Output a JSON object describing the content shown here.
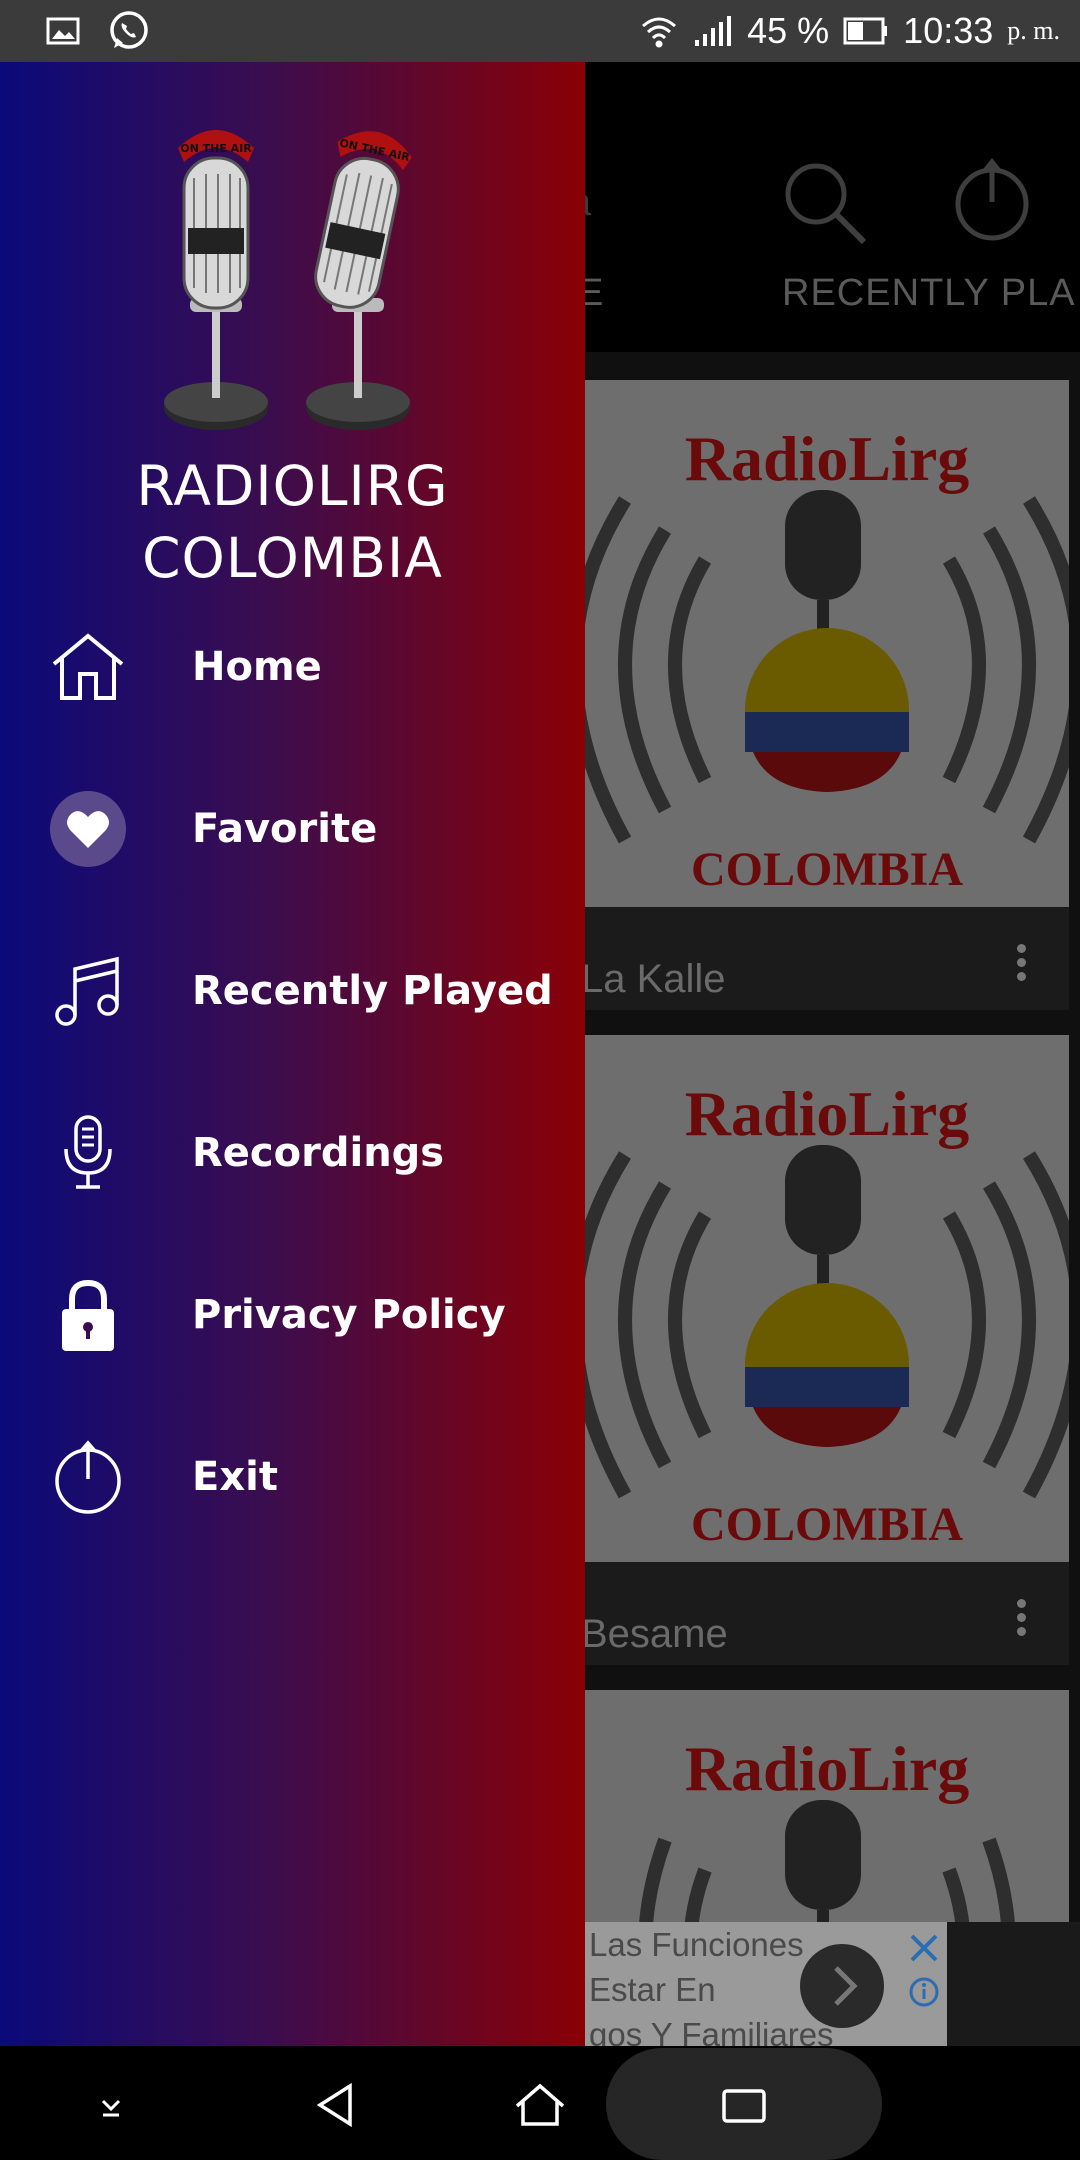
{
  "status_bar": {
    "battery": "45 %",
    "time": "10:33",
    "ampm": "p. m.",
    "icons": [
      "gallery-icon",
      "whatsapp-icon",
      "wifi-icon",
      "signal-icon",
      "battery-icon"
    ]
  },
  "background_app": {
    "title_fragment": "ia",
    "tabs": [
      "E",
      "RECENTLY PLA"
    ],
    "cards": [
      {
        "name": "La Kalle",
        "logo_text": "RadioLirg",
        "logo_sub": "COLOMBIA"
      },
      {
        "name": "Besame",
        "logo_text": "RadioLirg",
        "logo_sub": "COLOMBIA"
      },
      {
        "name": "",
        "logo_text": "RadioLirg",
        "logo_sub": ""
      }
    ],
    "ad_lines": [
      "Las Funciones",
      "Estar En",
      "gos Y Familiares"
    ]
  },
  "drawer": {
    "brand_line1": "RADIOLIRG",
    "brand_line2": "COLOMBIA",
    "logo_badge": "ON THE AIR",
    "items": [
      {
        "label": "Home",
        "icon": "home-icon"
      },
      {
        "label": "Favorite",
        "icon": "heart-icon"
      },
      {
        "label": "Recently Played",
        "icon": "music-note-icon"
      },
      {
        "label": "Recordings",
        "icon": "microphone-icon"
      },
      {
        "label": "Privacy Policy",
        "icon": "lock-icon"
      },
      {
        "label": "Exit",
        "icon": "power-icon"
      }
    ]
  },
  "colors": {
    "drawer_left": "#0a0a7a",
    "drawer_right": "#8a0006",
    "status_bar": "#3b3b3b"
  }
}
